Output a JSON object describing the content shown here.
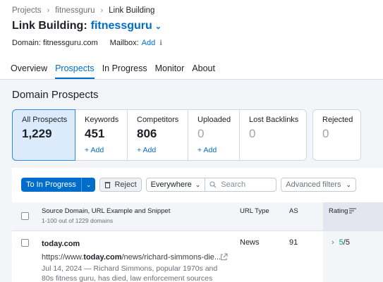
{
  "breadcrumb": {
    "items": [
      "Projects",
      "fitnessguru",
      "Link Building"
    ]
  },
  "header": {
    "title": "Link Building:",
    "project": "fitnessguru"
  },
  "meta": {
    "domain": "Domain: fitnessguru.com",
    "mailbox_label": "Mailbox:",
    "mailbox_action": "Add"
  },
  "tabs": [
    "Overview",
    "Prospects",
    "In Progress",
    "Monitor",
    "About"
  ],
  "active_tab": "Prospects",
  "section_title": "Domain Prospects",
  "cards": [
    {
      "label": "All Prospects",
      "value": "1,229",
      "action": ""
    },
    {
      "label": "Keywords",
      "value": "451",
      "action": "+ Add"
    },
    {
      "label": "Competitors",
      "value": "806",
      "action": "+ Add"
    },
    {
      "label": "Uploaded",
      "value": "0",
      "action": "+ Add"
    },
    {
      "label": "Lost Backlinks",
      "value": "0",
      "action": ""
    },
    {
      "label": "Rejected",
      "value": "0",
      "action": ""
    }
  ],
  "toolbar": {
    "primary": "To In Progress",
    "reject": "Reject",
    "location": "Everywhere",
    "search_placeholder": "Search",
    "filters": "Advanced filters"
  },
  "table": {
    "headers": {
      "source": "Source Domain, URL Example and Snippet",
      "count": "1-100 out of 1229 domains",
      "url_type": "URL Type",
      "as": "AS",
      "rating": "Rating"
    },
    "rows": [
      {
        "domain": "today.com",
        "url_pre": "https://www.",
        "url_bold": "today.com",
        "url_post": "/news/richard-simmons-die...",
        "snippet": "Jul 14, 2024 — Richard Simmons, popular 1970s and 80s fitness guru, has died, law enforcement sources",
        "url_type": "News",
        "as": "91",
        "rating_value": "5",
        "rating_max": "/5"
      }
    ]
  },
  "colors": {
    "accent": "#006dca",
    "rating_good": "#009f81"
  }
}
